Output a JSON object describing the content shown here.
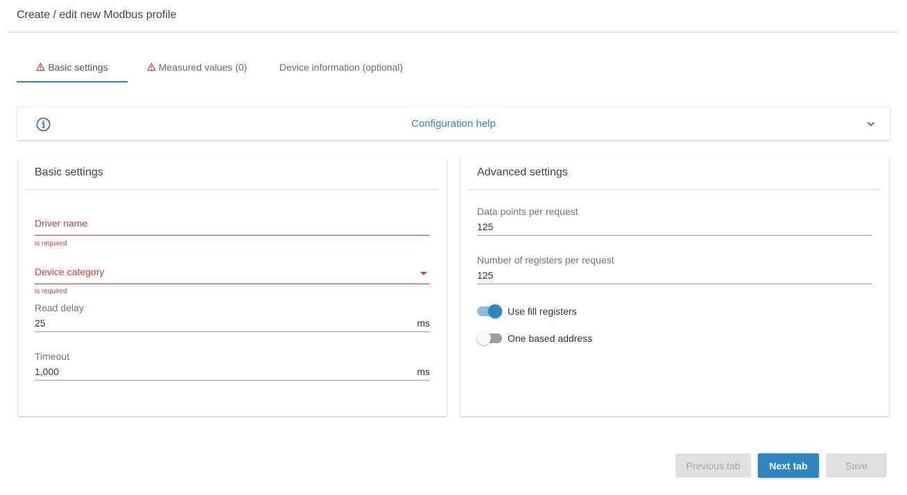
{
  "header": {
    "title": "Create / edit new Modbus profile"
  },
  "tabs": [
    {
      "label": "Basic settings",
      "warning": true,
      "active": true
    },
    {
      "label": "Measured values (0)",
      "warning": true,
      "active": false
    },
    {
      "label": "Device information (optional)",
      "warning": false,
      "active": false
    }
  ],
  "help": {
    "title": "Configuration help",
    "icon": "info-icon",
    "expand_icon": "chevron-down-icon"
  },
  "basic": {
    "title": "Basic settings",
    "driver_name": {
      "label": "Driver name",
      "error": "is required"
    },
    "device_category": {
      "label": "Device category",
      "error": "is required"
    },
    "read_delay": {
      "label": "Read delay",
      "value": "25",
      "unit": "ms"
    },
    "timeout": {
      "label": "Timeout",
      "value": "1,000",
      "unit": "ms"
    }
  },
  "advanced": {
    "title": "Advanced settings",
    "data_points": {
      "label": "Data points per request",
      "value": "125"
    },
    "registers": {
      "label": "Number of registers per request",
      "value": "125"
    },
    "fill_registers": {
      "label": "Use fill registers",
      "enabled": true
    },
    "one_based": {
      "label": "One based address",
      "enabled": false
    }
  },
  "buttons": {
    "previous": "Previous tab",
    "next": "Next tab",
    "save": "Save"
  },
  "colors": {
    "accent": "#2e86c1",
    "error": "#d93a3a",
    "disabled_bg": "#e0e0e0"
  }
}
